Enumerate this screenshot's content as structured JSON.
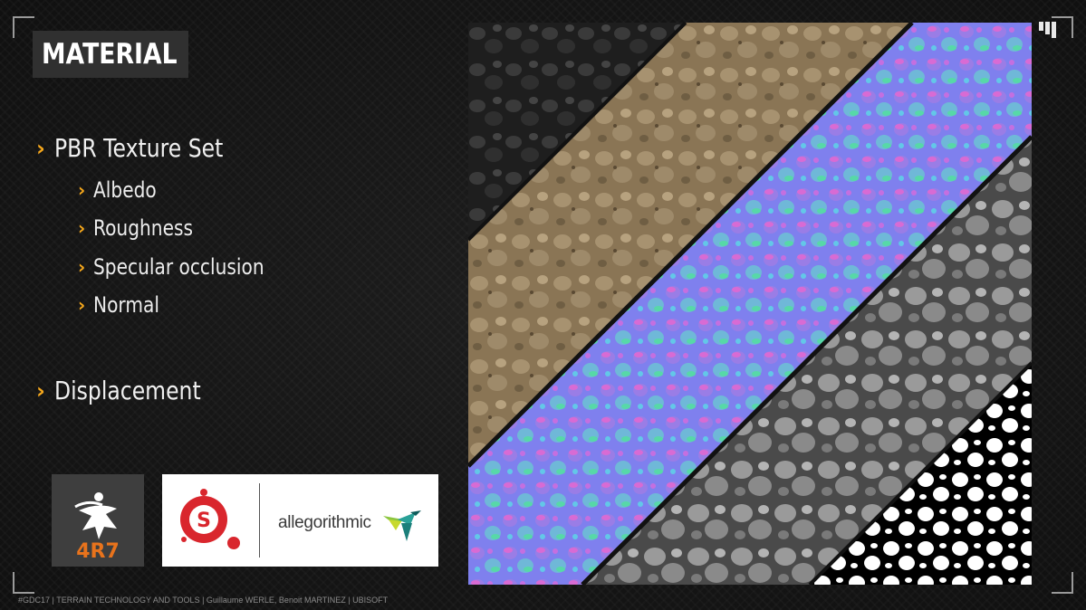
{
  "slide": {
    "title": "MATERIAL",
    "bullets": [
      {
        "text": "PBR Texture Set",
        "level": 1
      },
      {
        "text": "Albedo",
        "level": 2
      },
      {
        "text": "Roughness",
        "level": 2
      },
      {
        "text": "Specular occlusion",
        "level": 2
      },
      {
        "text": "Normal",
        "level": 2
      },
      {
        "text": "Displacement",
        "level": 1
      }
    ],
    "footer": "#GDC17 | TERRAIN TECHNOLOGY AND TOOLS | Guillaume WERLE, Benoit MARTINEZ | UBISOFT"
  },
  "logos": {
    "zbrush_version": "4R7",
    "substance_brand": "allegorithmic"
  },
  "colors": {
    "accent": "#f6a81c",
    "title_bg": "#303030",
    "substance_red": "#d9262d",
    "normal_map_blue": "#7f7fff"
  },
  "texture_panel": {
    "bands": [
      "roughness",
      "albedo",
      "normal",
      "displacement",
      "specular-occlusion-mask"
    ]
  }
}
